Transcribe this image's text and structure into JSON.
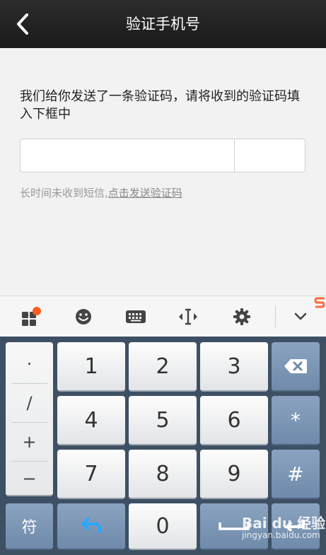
{
  "header": {
    "title": "验证手机号"
  },
  "main": {
    "description": "我们给你发送了一条验证码，请将收到的验证码填入下框中",
    "hint_prefix": "长时间未收到短信,",
    "hint_link": "点击发送验证码",
    "code_value": ""
  },
  "toolbar": {
    "icons": [
      "apps-icon",
      "emoji-icon",
      "keyboard-icon",
      "cursor-icon",
      "gear-icon",
      "chevron-down-icon"
    ],
    "notification_color": "#ff5a1f"
  },
  "keyboard": {
    "symbols": [
      "·",
      "/",
      "+",
      "−"
    ],
    "keys": {
      "k1": "1",
      "k2": "2",
      "k3": "3",
      "k4": "4",
      "k5": "5",
      "k6": "6",
      "k7": "7",
      "k8": "8",
      "k9": "9",
      "k0": "0",
      "star": "*",
      "hash": "#",
      "symbols_toggle": "符"
    }
  },
  "watermark": {
    "brand": "Bai du 经验",
    "url": "jingyan.baidu.com"
  },
  "colors": {
    "titlebar": "#1f1f1f",
    "keyboard_bg": "#3e5064",
    "blue_key": "#7a93b3"
  }
}
